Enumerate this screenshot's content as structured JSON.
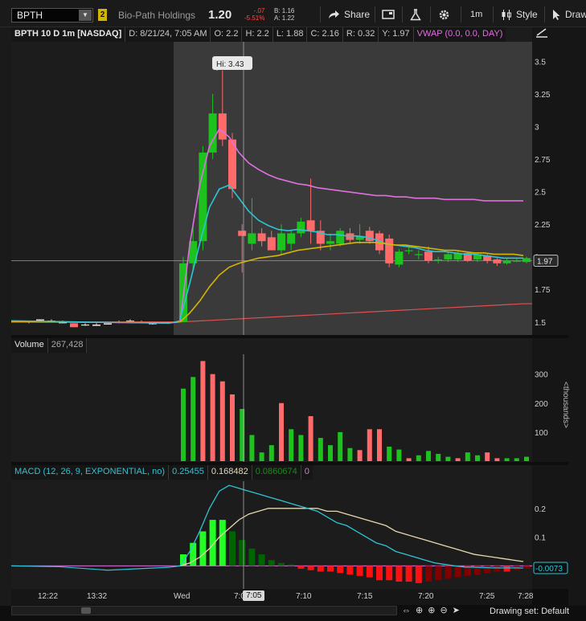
{
  "toolbar": {
    "symbol": "BPTH",
    "link_badge": "2",
    "company": "Bio-Path Holdings",
    "last_price": "1.20",
    "change": "-.07",
    "change_pct": "-5.51%",
    "bid": "B: 1.16",
    "ask": "A: 1.22",
    "share_label": "Share",
    "timeframe_label": "1m",
    "style_label": "Style",
    "drawing_label": "Draw"
  },
  "price_panel": {
    "header_title": "BPTH 10 D 1m [NASDAQ]",
    "date": "D: 8/21/24, 7:05 AM",
    "open": "O: 2.2",
    "high": "H: 2.2",
    "low": "L: 1.88",
    "close": "C: 2.16",
    "range": "R: 0.32",
    "y_val": "Y: 1.97",
    "vwap_label": "VWAP (0.0, 0.0, DAY)",
    "hi_bubble": "Hi: 3.43",
    "last_tag": "1.97",
    "y_ticks": [
      "3.5",
      "3.25",
      "3",
      "2.75",
      "2.5",
      "2.25",
      "2",
      "1.75",
      "1.5"
    ]
  },
  "volume_panel": {
    "title": "Volume",
    "value": "267,428",
    "y_ticks": [
      "300",
      "200",
      "100"
    ],
    "unit_label": "<thousands>"
  },
  "macd_panel": {
    "title": "MACD (12, 26, 9, EXPONENTIAL, no)",
    "value": "0.25455",
    "avg": "0.168482",
    "diff": "0.0860674",
    "zero": "0",
    "y_ticks": [
      "0.2",
      "0.1"
    ],
    "last_tag": "-0.0073"
  },
  "x_axis": {
    "labels": [
      "12:22",
      "13:32",
      "Wed",
      "7:0",
      "7:10",
      "7:15",
      "7:20",
      "7:25",
      "7:28"
    ],
    "cursor_time": "7:05"
  },
  "bottom": {
    "drawing_set": "Drawing set: Default"
  },
  "colors": {
    "up": "#1ec21e",
    "down": "#ff6b6b",
    "vwap": "#e070e0",
    "ema_fast": "#2ec4d4",
    "ema_slow": "#d4b600",
    "ema_long": "#e05050",
    "macd": "#2ec4d4",
    "signal": "#e8d8b0",
    "hist_pos_strong": "#22ff22",
    "hist_pos_weak": "#006400",
    "hist_neg_strong": "#ff1010",
    "hist_neg_weak": "#800000"
  },
  "chart_data": [
    {
      "type": "candlestick",
      "title": "BPTH 10 D 1m [NASDAQ]",
      "ylim": [
        1.4,
        3.65
      ],
      "y_ticks": [
        3.5,
        3.25,
        3,
        2.75,
        2.5,
        2.25,
        2,
        1.75,
        1.5
      ],
      "x_labels": [
        "12:22",
        "13:32",
        "Wed",
        "7:0",
        "7:10",
        "7:15",
        "7:20",
        "7:25",
        "7:28"
      ],
      "premarket_candles": [
        {
          "i": 0,
          "o": 1.5,
          "h": 1.51,
          "l": 1.49,
          "c": 1.51
        },
        {
          "i": 1,
          "o": 1.51,
          "h": 1.52,
          "l": 1.5,
          "c": 1.52
        },
        {
          "i": 2,
          "o": 1.51,
          "h": 1.52,
          "l": 1.5,
          "c": 1.51
        },
        {
          "i": 3,
          "o": 1.5,
          "h": 1.51,
          "l": 1.49,
          "c": 1.49
        },
        {
          "i": 4,
          "o": 1.49,
          "h": 1.49,
          "l": 1.46,
          "c": 1.46
        },
        {
          "i": 5,
          "o": 1.48,
          "h": 1.49,
          "l": 1.47,
          "c": 1.48
        },
        {
          "i": 6,
          "o": 1.48,
          "h": 1.49,
          "l": 1.47,
          "c": 1.47
        },
        {
          "i": 7,
          "o": 1.49,
          "h": 1.49,
          "l": 1.48,
          "c": 1.48
        },
        {
          "i": 8,
          "o": 1.5,
          "h": 1.51,
          "l": 1.49,
          "c": 1.5
        },
        {
          "i": 9,
          "o": 1.51,
          "h": 1.52,
          "l": 1.5,
          "c": 1.51
        },
        {
          "i": 10,
          "o": 1.5,
          "h": 1.51,
          "l": 1.49,
          "c": 1.5
        },
        {
          "i": 11,
          "o": 1.49,
          "h": 1.5,
          "l": 1.48,
          "c": 1.49
        }
      ],
      "session_candles": [
        {
          "o": 1.5,
          "h": 2.0,
          "l": 1.5,
          "c": 1.95
        },
        {
          "o": 1.95,
          "h": 2.25,
          "l": 1.9,
          "c": 2.12
        },
        {
          "o": 2.12,
          "h": 2.85,
          "l": 2.05,
          "c": 2.8
        },
        {
          "o": 2.8,
          "h": 3.25,
          "l": 2.75,
          "c": 3.1
        },
        {
          "o": 3.1,
          "h": 3.43,
          "l": 2.85,
          "c": 2.9
        },
        {
          "o": 2.9,
          "h": 2.95,
          "l": 2.45,
          "c": 2.52
        },
        {
          "o": 2.2,
          "h": 2.25,
          "l": 1.88,
          "c": 2.16
        },
        {
          "o": 2.1,
          "h": 2.45,
          "l": 2.05,
          "c": 2.18
        },
        {
          "o": 2.18,
          "h": 2.22,
          "l": 2.08,
          "c": 2.12
        },
        {
          "o": 2.15,
          "h": 2.2,
          "l": 2.05,
          "c": 2.05
        },
        {
          "o": 2.05,
          "h": 2.25,
          "l": 2.02,
          "c": 2.18
        },
        {
          "o": 2.1,
          "h": 2.2,
          "l": 2.05,
          "c": 2.18
        },
        {
          "o": 2.18,
          "h": 2.3,
          "l": 2.15,
          "c": 2.27
        },
        {
          "o": 2.28,
          "h": 2.6,
          "l": 2.1,
          "c": 2.2
        },
        {
          "o": 2.2,
          "h": 2.28,
          "l": 2.05,
          "c": 2.1
        },
        {
          "o": 2.1,
          "h": 2.18,
          "l": 2.05,
          "c": 2.12
        },
        {
          "o": 2.1,
          "h": 2.22,
          "l": 2.08,
          "c": 2.2
        },
        {
          "o": 2.18,
          "h": 2.22,
          "l": 2.1,
          "c": 2.13
        },
        {
          "o": 2.13,
          "h": 2.25,
          "l": 2.1,
          "c": 2.16
        },
        {
          "o": 2.2,
          "h": 2.23,
          "l": 2.1,
          "c": 2.12
        },
        {
          "o": 2.18,
          "h": 2.2,
          "l": 2.02,
          "c": 2.05
        },
        {
          "o": 2.14,
          "h": 2.17,
          "l": 1.92,
          "c": 1.95
        },
        {
          "o": 1.94,
          "h": 2.06,
          "l": 1.92,
          "c": 2.04
        },
        {
          "o": 2.05,
          "h": 2.08,
          "l": 2.02,
          "c": 2.05
        },
        {
          "o": 2.02,
          "h": 2.05,
          "l": 1.98,
          "c": 2.02
        },
        {
          "o": 2.04,
          "h": 2.08,
          "l": 1.95,
          "c": 1.97
        },
        {
          "o": 1.97,
          "h": 2.0,
          "l": 1.95,
          "c": 1.98
        },
        {
          "o": 1.98,
          "h": 2.04,
          "l": 1.96,
          "c": 2.02
        },
        {
          "o": 1.98,
          "h": 2.04,
          "l": 1.96,
          "c": 2.03
        },
        {
          "o": 2.03,
          "h": 2.04,
          "l": 1.96,
          "c": 1.97
        },
        {
          "o": 1.98,
          "h": 2.03,
          "l": 1.96,
          "c": 2.02
        },
        {
          "o": 2.01,
          "h": 2.02,
          "l": 1.95,
          "c": 1.97
        },
        {
          "o": 1.98,
          "h": 1.99,
          "l": 1.93,
          "c": 1.95
        },
        {
          "o": 1.95,
          "h": 1.99,
          "l": 1.94,
          "c": 1.97
        },
        {
          "o": 1.97,
          "h": 1.99,
          "l": 1.96,
          "c": 1.97
        },
        {
          "o": 1.96,
          "h": 2.0,
          "l": 1.95,
          "c": 1.99
        }
      ],
      "vwap": [
        1.5,
        2.1,
        2.55,
        2.85,
        2.98,
        2.92,
        2.8,
        2.72,
        2.67,
        2.63,
        2.6,
        2.58,
        2.56,
        2.55,
        2.53,
        2.52,
        2.51,
        2.5,
        2.49,
        2.48,
        2.47,
        2.47,
        2.46,
        2.46,
        2.45,
        2.45,
        2.45,
        2.44,
        2.44,
        2.44,
        2.44,
        2.43,
        2.43,
        2.43,
        2.43,
        2.43
      ],
      "ema_fast": [
        1.52,
        1.8,
        2.1,
        2.38,
        2.52,
        2.55,
        2.45,
        2.35,
        2.28,
        2.24,
        2.21,
        2.2,
        2.21,
        2.2,
        2.19,
        2.17,
        2.17,
        2.16,
        2.16,
        2.15,
        2.13,
        2.1,
        2.09,
        2.08,
        2.07,
        2.05,
        2.04,
        2.04,
        2.03,
        2.02,
        2.02,
        2.01,
        2.0,
        1.99,
        1.99,
        1.99
      ],
      "ema_slow": [
        1.5,
        1.57,
        1.66,
        1.77,
        1.86,
        1.92,
        1.95,
        1.97,
        1.99,
        2.0,
        2.01,
        2.03,
        2.05,
        2.06,
        2.07,
        2.08,
        2.09,
        2.1,
        2.11,
        2.11,
        2.11,
        2.1,
        2.09,
        2.09,
        2.08,
        2.07,
        2.06,
        2.05,
        2.05,
        2.04,
        2.03,
        2.03,
        2.02,
        2.02,
        2.02,
        2.01
      ],
      "ema_long_start": 1.5,
      "ema_long_end": 1.64,
      "last_price": 1.97
    },
    {
      "type": "bar",
      "title": "Volume",
      "ylim": [
        0,
        360
      ],
      "y_ticks": [
        300,
        200,
        100
      ],
      "unit": "thousands",
      "values": [
        250,
        290,
        345,
        300,
        275,
        230,
        180,
        90,
        30,
        55,
        200,
        110,
        90,
        155,
        80,
        55,
        100,
        45,
        38,
        110,
        110,
        50,
        40,
        10,
        20,
        35,
        25,
        15,
        10,
        30,
        20,
        30,
        10,
        10,
        10,
        15
      ],
      "up": [
        true,
        true,
        false,
        false,
        false,
        false,
        true,
        true,
        true,
        true,
        false,
        true,
        true,
        false,
        true,
        true,
        true,
        true,
        false,
        false,
        false,
        true,
        true,
        false,
        true,
        true,
        true,
        true,
        false,
        true,
        true,
        false,
        false,
        true,
        true,
        true
      ]
    },
    {
      "type": "line",
      "title": "MACD (12, 26, 9, EXPONENTIAL, no)",
      "ylim": [
        -0.08,
        0.3
      ],
      "y_ticks": [
        0.2,
        0.1
      ],
      "series": [
        {
          "name": "MACD",
          "values": [
            0.0,
            0.05,
            0.12,
            0.2,
            0.26,
            0.28,
            0.27,
            0.26,
            0.25,
            0.24,
            0.23,
            0.22,
            0.21,
            0.2,
            0.19,
            0.17,
            0.15,
            0.14,
            0.12,
            0.1,
            0.08,
            0.07,
            0.05,
            0.04,
            0.03,
            0.02,
            0.01,
            0.005,
            0.0,
            -0.004,
            -0.005,
            -0.006,
            -0.007,
            -0.007,
            -0.007,
            -0.0073
          ]
        },
        {
          "name": "Avg",
          "values": [
            0.0,
            0.01,
            0.03,
            0.06,
            0.1,
            0.13,
            0.16,
            0.18,
            0.19,
            0.2,
            0.2,
            0.2,
            0.2,
            0.2,
            0.2,
            0.19,
            0.19,
            0.18,
            0.17,
            0.16,
            0.15,
            0.14,
            0.12,
            0.11,
            0.1,
            0.09,
            0.08,
            0.07,
            0.06,
            0.05,
            0.04,
            0.035,
            0.03,
            0.025,
            0.02,
            0.015
          ]
        }
      ],
      "histogram": [
        0.04,
        0.08,
        0.12,
        0.16,
        0.16,
        0.12,
        0.09,
        0.06,
        0.04,
        0.02,
        0.01,
        0.005,
        -0.01,
        -0.015,
        -0.02,
        -0.02,
        -0.025,
        -0.03,
        -0.035,
        -0.04,
        -0.05,
        -0.05,
        -0.055,
        -0.055,
        -0.06,
        -0.055,
        -0.05,
        -0.045,
        -0.04,
        -0.035,
        -0.03,
        -0.025,
        -0.02,
        -0.02,
        -0.015,
        -0.01
      ]
    }
  ]
}
